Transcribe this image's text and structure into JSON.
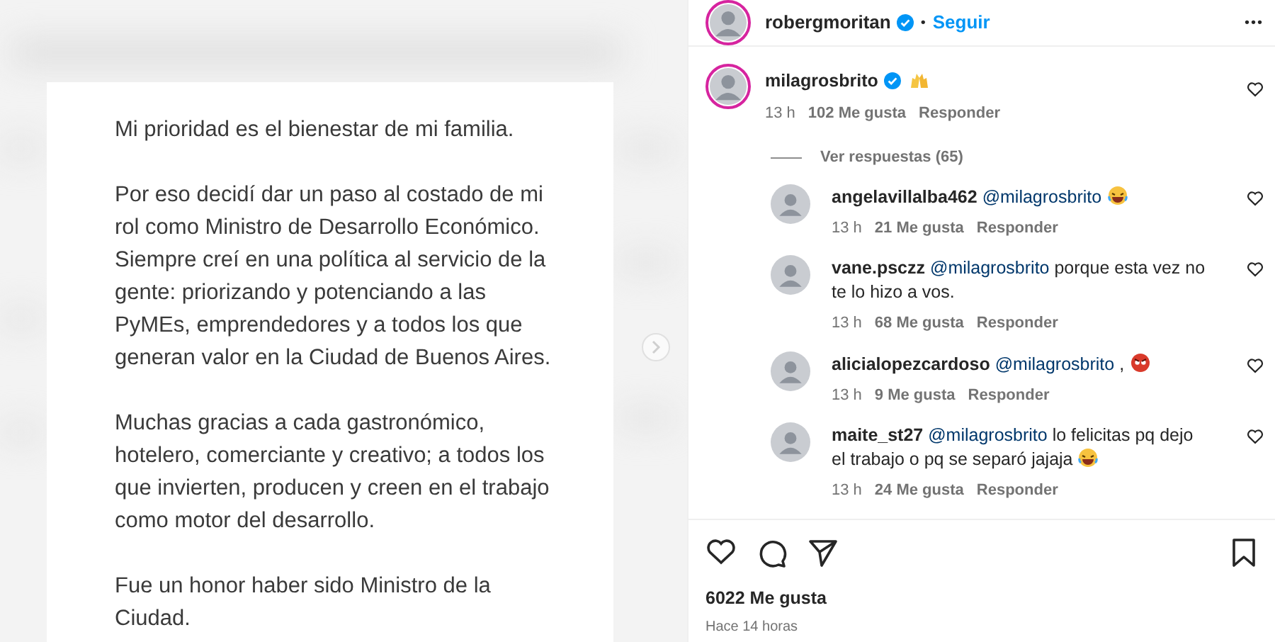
{
  "post": {
    "paragraphs": [
      [
        "Mi prioridad es el bienestar de mi familia."
      ],
      [
        "Por eso decidí dar un paso al costado de mi",
        "rol como Ministro de Desarrollo Económico.",
        "Siempre creí en una política al servicio de la",
        "gente: priorizando y potenciando a las",
        "PyMEs, emprendedores y a todos los que",
        "generan valor en la Ciudad de Buenos Aires."
      ],
      [
        "Muchas gracias a cada gastronómico,",
        "hotelero, comerciante y creativo; a todos los",
        "que invierten, producen y creen en el trabajo",
        "como motor del desarrollo."
      ],
      [
        "Fue un honor haber sido Ministro de la",
        "Ciudad."
      ]
    ]
  },
  "header": {
    "username": "robergmoritan",
    "verified": true,
    "separator": "•",
    "follow": "Seguir",
    "more": "•••"
  },
  "comment": {
    "username": "milagrosbrito",
    "verified": true,
    "emoji": {
      "kind": "hands"
    },
    "time": "13 h",
    "likes": "102 Me gusta",
    "reply": "Responder"
  },
  "view_replies": "Ver respuestas (65)",
  "replies": [
    {
      "username": "angelavillalba462",
      "mention": "@milagrosbrito",
      "emoji": {
        "kind": "laugh"
      },
      "time": "13 h",
      "likes": "21 Me gusta",
      "reply": "Responder"
    },
    {
      "username": "vane.psczz",
      "mention": "@milagrosbrito",
      "text": "porque esta vez no te lo hizo a vos.",
      "time": "13 h",
      "likes": "68 Me gusta",
      "reply": "Responder"
    },
    {
      "username": "alicialopezcardoso",
      "mention": "@milagrosbrito",
      "text": ",",
      "emoji": {
        "kind": "angry"
      },
      "time": "13 h",
      "likes": "9 Me gusta",
      "reply": "Responder"
    },
    {
      "username": "maite_st27",
      "mention": "@milagrosbrito",
      "text": "lo felicitas pq dejo el trabajo o pq se separó jajaja",
      "emoji": {
        "kind": "laugh"
      },
      "time": "13 h",
      "likes": "24 Me gusta",
      "reply": "Responder"
    }
  ],
  "likes": "6022 Me gusta",
  "posted": "Hace 14 horas"
}
